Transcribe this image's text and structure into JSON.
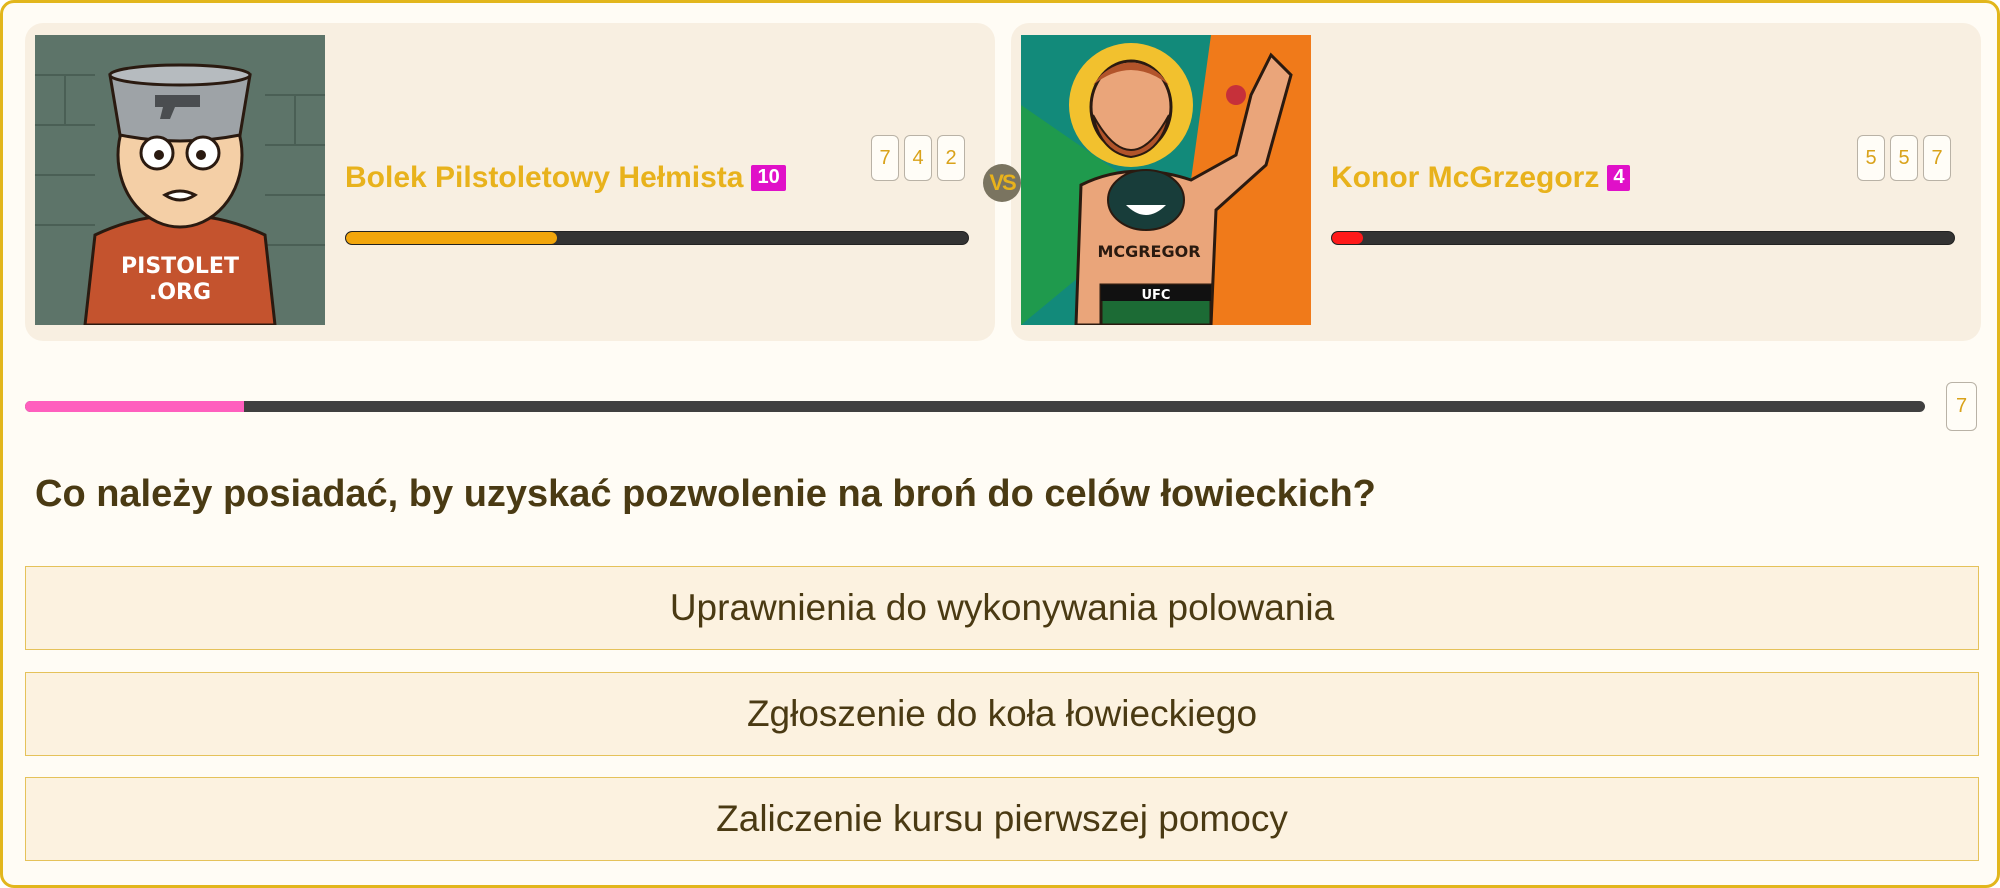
{
  "players": [
    {
      "name": "Bolek Pilstoletowy Hełmista",
      "level": "10",
      "stats": [
        "7",
        "4",
        "2"
      ],
      "hp_fraction": 0.34,
      "hp_color": "#f2a60c",
      "avatar_text": [
        "PISTOLET",
        ".ORG"
      ]
    },
    {
      "name": "Konor McGrzegorz",
      "level": "4",
      "stats": [
        "5",
        "5",
        "7"
      ],
      "hp_fraction": 0.05,
      "hp_color": "#ff1a1a",
      "avatar_text": [
        "MCGREGOR",
        "UFC"
      ]
    }
  ],
  "vs_label": "VS",
  "timer": {
    "fraction": 0.115,
    "seconds": "7"
  },
  "question": "Co należy posiadać, by uzyskać pozwolenie na broń do celów łowieckich?",
  "answers": [
    "Uprawnienia do wykonywania polowania",
    "Zgłoszenie do koła łowieckiego",
    "Zaliczenie kursu pierwszej pomocy"
  ],
  "colors": {
    "accent": "#e8b21c",
    "level_badge": "#e010c8",
    "timer_fill": "#ff5fbe"
  }
}
